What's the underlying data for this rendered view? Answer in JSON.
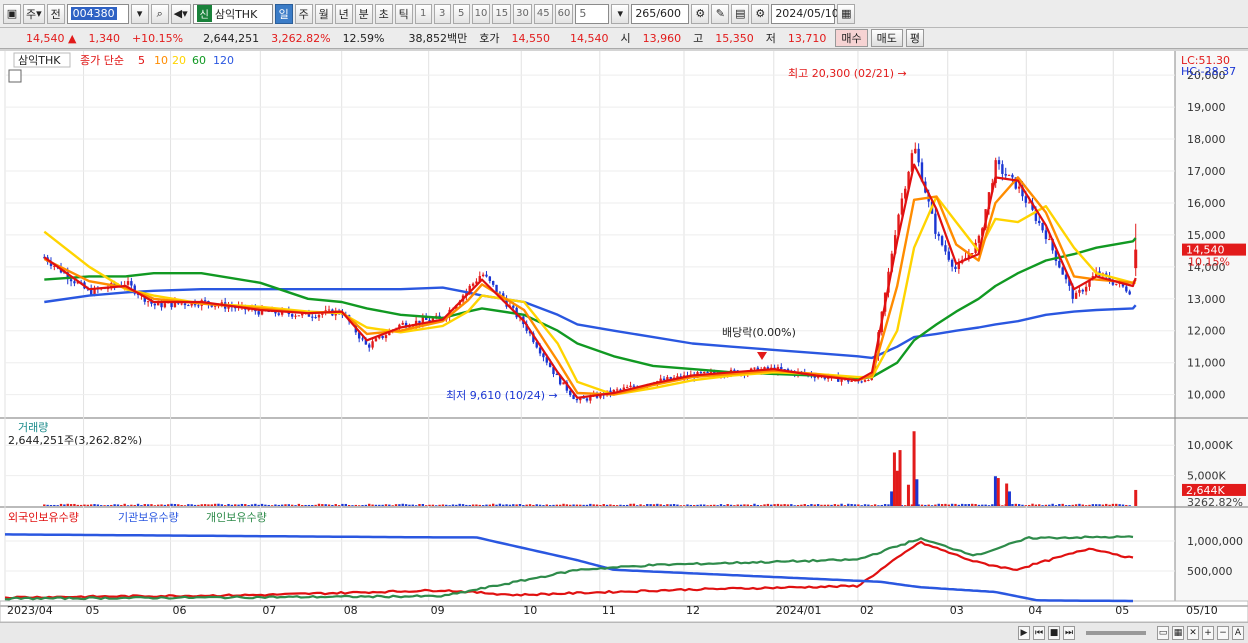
{
  "toolbar": {
    "market": "주",
    "prev_label": "전",
    "stock_code": "004380",
    "new_tag": "신",
    "stock_name": "삼익THK",
    "periods": [
      "일",
      "주",
      "월",
      "년",
      "분",
      "초",
      "틱"
    ],
    "active_period": "일",
    "minute_options": [
      "1",
      "3",
      "5",
      "10",
      "15",
      "30",
      "45",
      "60"
    ],
    "interval_value": "5",
    "count": "265",
    "count_max": "/600",
    "date": "2024/05/10"
  },
  "quote": {
    "price": "14,540",
    "change_symbol": "▲",
    "change": "1,340",
    "change_pct": "+10.15%",
    "volume": "2,644,251",
    "volume_ratio": "3,262.82%",
    "turnover": "12.59%",
    "trade_value": "38,852백만",
    "ask_label": "호가",
    "ask": "14,550",
    "bid": "14,540",
    "open_label": "시",
    "open": "13,960",
    "high_label": "고",
    "high": "15,350",
    "low_label": "저",
    "low": "13,710",
    "buy": "매수",
    "sell": "매도",
    "eval": "평"
  },
  "colors": {
    "up": "#e21b1b",
    "down": "#1b36d3",
    "ma5": "#e01010",
    "ma10": "#ff8c00",
    "ma20": "#ffd400",
    "ma60": "#119922",
    "ma120": "#2a57e0",
    "foreign": "#e01010",
    "inst": "#2a57e0",
    "indiv": "#2e8b4a"
  },
  "chart_data": [
    {
      "type": "candlestick",
      "legend": {
        "name": "삼익THK",
        "ma_title": "종가 단순",
        "ma_periods": [
          "5",
          "10",
          "20",
          "60",
          "120"
        ]
      },
      "yticks": [
        "10,000",
        "11,000",
        "12,000",
        "13,000",
        "14,000",
        "15,000",
        "16,000",
        "17,000",
        "18,000",
        "19,000",
        "20,000"
      ],
      "ylim": [
        9300,
        20600
      ],
      "x_labels": [
        "2023/04",
        "05",
        "06",
        "07",
        "08",
        "09",
        "10",
        "11",
        "12",
        "2024/01",
        "02",
        "03",
        "04",
        "05",
        "05/10"
      ],
      "lc": "LC:51.30",
      "hc": "HC:-28.37",
      "price_tag": "14,540",
      "pct_tag": "10.15%",
      "annotations": {
        "high": "최고 20,300 (02/21) →",
        "low": "최저 9,610 (10/24) →",
        "dividend": "배당락(0.00%)"
      },
      "close": [
        {
          "date": "2023-04-17",
          "value": 14300
        },
        {
          "date": "2023-05-03",
          "value": 13200
        },
        {
          "date": "2023-05-16",
          "value": 13500
        },
        {
          "date": "2023-05-26",
          "value": 12800
        },
        {
          "date": "2023-06-12",
          "value": 12900
        },
        {
          "date": "2023-07-03",
          "value": 12600
        },
        {
          "date": "2023-07-20",
          "value": 12500
        },
        {
          "date": "2023-08-01",
          "value": 12600
        },
        {
          "date": "2023-08-10",
          "value": 11500
        },
        {
          "date": "2023-08-22",
          "value": 12200
        },
        {
          "date": "2023-09-06",
          "value": 12400
        },
        {
          "date": "2023-09-15",
          "value": 13300
        },
        {
          "date": "2023-09-20",
          "value": 13800
        },
        {
          "date": "2023-10-05",
          "value": 12200
        },
        {
          "date": "2023-10-17",
          "value": 10500
        },
        {
          "date": "2023-10-24",
          "value": 9800
        },
        {
          "date": "2023-11-06",
          "value": 10100
        },
        {
          "date": "2023-11-20",
          "value": 10400
        },
        {
          "date": "2023-12-04",
          "value": 10600
        },
        {
          "date": "2023-12-18",
          "value": 10700
        },
        {
          "date": "2024-01-02",
          "value": 10800
        },
        {
          "date": "2024-01-17",
          "value": 10600
        },
        {
          "date": "2024-02-01",
          "value": 10400
        },
        {
          "date": "2024-02-06",
          "value": 10600
        },
        {
          "date": "2024-02-15",
          "value": 15500
        },
        {
          "date": "2024-02-21",
          "value": 17800
        },
        {
          "date": "2024-02-29",
          "value": 15000
        },
        {
          "date": "2024-03-07",
          "value": 13900
        },
        {
          "date": "2024-03-15",
          "value": 14800
        },
        {
          "date": "2024-03-21",
          "value": 17200
        },
        {
          "date": "2024-03-29",
          "value": 16500
        },
        {
          "date": "2024-04-08",
          "value": 15000
        },
        {
          "date": "2024-04-18",
          "value": 13000
        },
        {
          "date": "2024-04-26",
          "value": 13800
        },
        {
          "date": "2024-05-09",
          "value": 13200
        },
        {
          "date": "2024-05-10",
          "value": 14540
        }
      ],
      "ma": [
        {
          "period": "5",
          "values": [
            14300,
            13300,
            13400,
            12900,
            12900,
            12650,
            12550,
            12600,
            11700,
            12100,
            12350,
            13150,
            13600,
            12300,
            10700,
            9900,
            10050,
            10350,
            10600,
            10700,
            10800,
            10600,
            10450,
            10700,
            14800,
            17200,
            15800,
            14100,
            14400,
            16800,
            16700,
            15300,
            13300,
            13700,
            13400,
            13650
          ]
        },
        {
          "period": "10",
          "values": [
            14250,
            13550,
            13350,
            13000,
            12850,
            12700,
            12550,
            12600,
            11900,
            12000,
            12300,
            12950,
            13450,
            12650,
            11050,
            10050,
            10000,
            10300,
            10550,
            10650,
            10750,
            10650,
            10450,
            10600,
            13400,
            16100,
            16200,
            14700,
            14200,
            16000,
            16800,
            15700,
            13700,
            13600,
            13500,
            13600
          ]
        },
        {
          "period": "20",
          "values": [
            15100,
            14000,
            13300,
            13100,
            12850,
            12750,
            12600,
            12550,
            12100,
            11950,
            12150,
            12600,
            13100,
            12900,
            11600,
            10400,
            10000,
            10200,
            10450,
            10600,
            10700,
            10650,
            10550,
            10550,
            12000,
            14600,
            16200,
            15400,
            14500,
            15500,
            15400,
            15900,
            14600,
            13800,
            13500,
            13500
          ]
        },
        {
          "period": "60",
          "values": [
            13600,
            13700,
            13700,
            13800,
            13800,
            13500,
            13000,
            12900,
            12700,
            12500,
            12400,
            12600,
            12700,
            12500,
            12000,
            11600,
            11200,
            10900,
            10800,
            10700,
            10650,
            10600,
            10500,
            10550,
            11000,
            11700,
            12200,
            12600,
            13000,
            13400,
            13800,
            14200,
            14400,
            14600,
            14800,
            14900
          ]
        },
        {
          "period": "120",
          "values": [
            12900,
            13100,
            13200,
            13250,
            13300,
            13300,
            13300,
            13300,
            13300,
            13300,
            13350,
            13200,
            13100,
            12900,
            12500,
            12200,
            12000,
            11800,
            11600,
            11500,
            11400,
            11300,
            11200,
            11150,
            11500,
            11800,
            11900,
            12000,
            12100,
            12200,
            12300,
            12500,
            12600,
            12650,
            12700,
            12800
          ]
        }
      ]
    },
    {
      "type": "bar",
      "title": "거래량",
      "summary": "2,644,251주(3,262.82%)",
      "yticks": [
        "5,000K",
        "10,000K"
      ],
      "last_tag": "2,644K",
      "last_pct": "3262.82%",
      "values_k": [
        {
          "date": "2024-02-13",
          "value": 2400,
          "dir": "down"
        },
        {
          "date": "2024-02-14",
          "value": 8800,
          "dir": "up"
        },
        {
          "date": "2024-02-15",
          "value": 5800,
          "dir": "up"
        },
        {
          "date": "2024-02-16",
          "value": 9200,
          "dir": "up"
        },
        {
          "date": "2024-02-19",
          "value": 3500,
          "dir": "up"
        },
        {
          "date": "2024-02-21",
          "value": 12300,
          "dir": "up"
        },
        {
          "date": "2024-02-22",
          "value": 4400,
          "dir": "down"
        },
        {
          "date": "2024-03-21",
          "value": 4900,
          "dir": "down"
        },
        {
          "date": "2024-03-22",
          "value": 4600,
          "dir": "up"
        },
        {
          "date": "2024-03-25",
          "value": 3700,
          "dir": "up"
        },
        {
          "date": "2024-03-26",
          "value": 2400,
          "dir": "down"
        },
        {
          "date": "2024-05-10",
          "value": 2644,
          "dir": "up"
        }
      ]
    },
    {
      "type": "line",
      "series_names": [
        "외국인보유수량",
        "기관보유수량",
        "개인보유수량"
      ],
      "yticks": [
        "500,000",
        "1,000,000"
      ],
      "foreign": [
        {
          "date": "2023-04-03",
          "value": 60000
        },
        {
          "date": "2023-07-03",
          "value": 100000
        },
        {
          "date": "2023-09-06",
          "value": 180000
        },
        {
          "date": "2023-10-02",
          "value": 100000
        },
        {
          "date": "2023-12-01",
          "value": 190000
        },
        {
          "date": "2024-02-01",
          "value": 250000
        },
        {
          "date": "2024-02-23",
          "value": 980000
        },
        {
          "date": "2024-03-14",
          "value": 650000
        },
        {
          "date": "2024-03-28",
          "value": 520000
        },
        {
          "date": "2024-04-24",
          "value": 880000
        },
        {
          "date": "2024-05-10",
          "value": 700000
        }
      ],
      "institution": [
        {
          "date": "2023-04-03",
          "value": 1110000
        },
        {
          "date": "2023-09-04",
          "value": 1060000
        },
        {
          "date": "2023-09-18",
          "value": 1060000
        },
        {
          "date": "2023-10-24",
          "value": 680000
        },
        {
          "date": "2023-11-06",
          "value": 520000
        },
        {
          "date": "2024-02-09",
          "value": 320000
        },
        {
          "date": "2024-02-23",
          "value": 230000
        },
        {
          "date": "2024-03-21",
          "value": 150000
        },
        {
          "date": "2024-04-05",
          "value": 10000
        },
        {
          "date": "2024-05-10",
          "value": 0
        }
      ],
      "individual": [
        {
          "date": "2023-04-03",
          "value": 40000
        },
        {
          "date": "2023-09-06",
          "value": 80000
        },
        {
          "date": "2023-10-24",
          "value": 520000
        },
        {
          "date": "2023-11-20",
          "value": 600000
        },
        {
          "date": "2024-02-01",
          "value": 690000
        },
        {
          "date": "2024-02-23",
          "value": 1040000
        },
        {
          "date": "2024-03-14",
          "value": 760000
        },
        {
          "date": "2024-04-02",
          "value": 1050000
        },
        {
          "date": "2024-05-10",
          "value": 1070000
        }
      ]
    }
  ],
  "bottom": {
    "controls": [
      "▶",
      "⏮",
      "■",
      "⏭",
      "+",
      "−",
      "A"
    ]
  }
}
